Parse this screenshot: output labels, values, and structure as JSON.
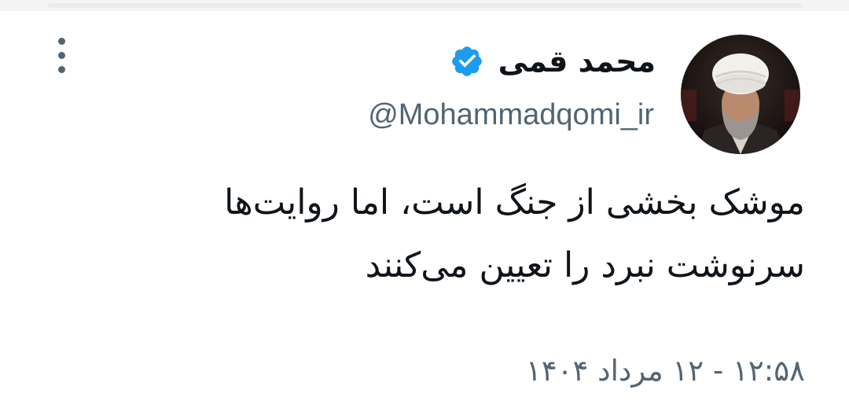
{
  "tweet": {
    "author": {
      "display_name": "محمد قمی",
      "handle": "@Mohammadqomi_ir",
      "verified": true,
      "avatar": "avatar"
    },
    "text_lines": [
      "موشک بخشی از جنگ است، اما روایت‌ها",
      "سرنوشت نبرد را تعیین می‌کنند"
    ],
    "timestamp": "۱۲:۵۸ - ۱۲ مرداد ۱۴۰۴"
  },
  "icons": {
    "verified": "verified-badge-icon",
    "more": "more-vertical-icon"
  },
  "colors": {
    "verified_blue": "#1d9bf0",
    "text_primary": "#0f1419",
    "text_secondary": "#536471",
    "background": "#ffffff"
  }
}
